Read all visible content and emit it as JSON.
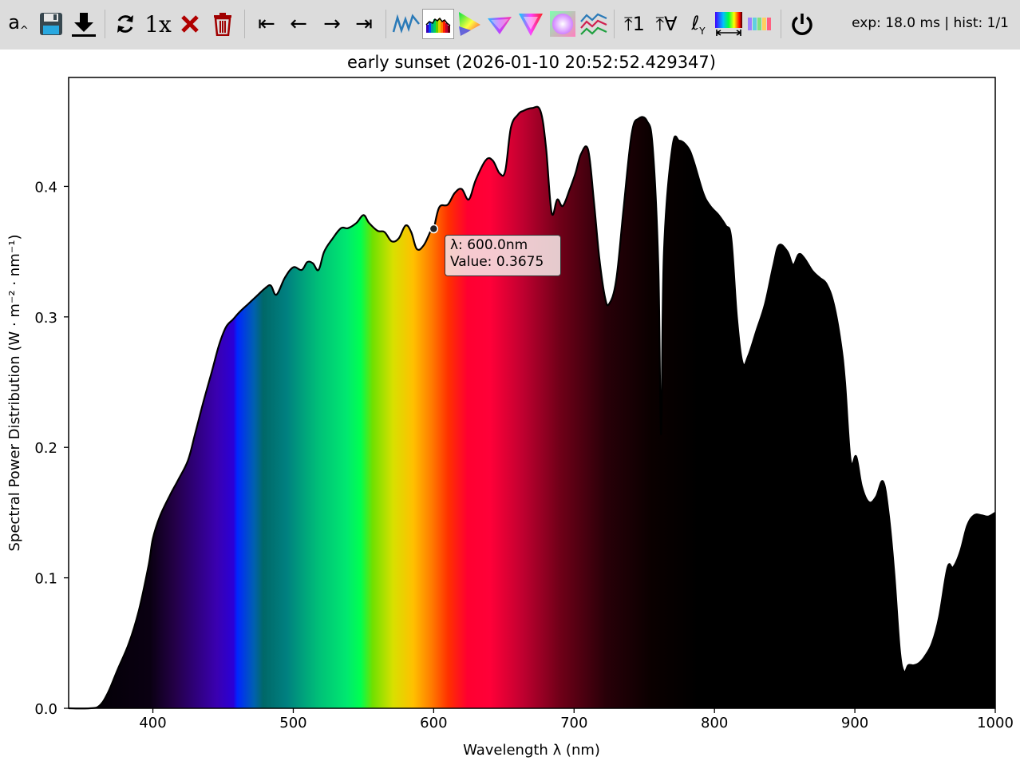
{
  "toolbar": {
    "font_size_label": "a",
    "speed_label": "1x",
    "status": "exp: 18.0 ms | hist: 1/1",
    "norm_one_label": "⤒1",
    "norm_all_label": "⤒∀",
    "log_label": "ℓ",
    "first_label": "⇤",
    "prev_label": "←",
    "next_label": "→",
    "last_label": "⇥"
  },
  "chart_data": {
    "type": "area",
    "title": "early sunset (2026-01-10 20:52:52.429347)",
    "xlabel": "Wavelength λ (nm)",
    "ylabel": "Spectral Power Distribution (W · m⁻² · nm⁻¹)",
    "xlim": [
      340,
      1000
    ],
    "ylim": [
      0,
      0.4835
    ],
    "xticks": [
      "400",
      "500",
      "600",
      "700",
      "800",
      "900",
      "1000"
    ],
    "yticks": [
      "0.0",
      "0.1",
      "0.2",
      "0.3",
      "0.4"
    ],
    "grid": false,
    "x": [
      340,
      355,
      362,
      368,
      375,
      383,
      390,
      397,
      400,
      405,
      412,
      418,
      425,
      430,
      436,
      442,
      447,
      452,
      457,
      462,
      468,
      474,
      480,
      484,
      488,
      494,
      500,
      506,
      510,
      514,
      518,
      522,
      528,
      534,
      539,
      545,
      550,
      554,
      560,
      565,
      570,
      575,
      580,
      584,
      588,
      593,
      598,
      600,
      604,
      610,
      615,
      620,
      625,
      630,
      637,
      642,
      647,
      651,
      655,
      660,
      664,
      670,
      676,
      680,
      684,
      688,
      692,
      697,
      701,
      705,
      710,
      714,
      718,
      722,
      725,
      730,
      735,
      741,
      746,
      752,
      756,
      760,
      762,
      764,
      770,
      775,
      781,
      785,
      792,
      797,
      803,
      808,
      812,
      816,
      820,
      824,
      830,
      836,
      842,
      846,
      852,
      856,
      860,
      864,
      870,
      875,
      880,
      885,
      890,
      893,
      897,
      901,
      905,
      910,
      915,
      920,
      924,
      928,
      932,
      935,
      938,
      942,
      946,
      950,
      955,
      960,
      966,
      970,
      975,
      980,
      985,
      990,
      995,
      1000
    ],
    "values": [
      0,
      0,
      0.002,
      0.012,
      0.03,
      0.05,
      0.075,
      0.11,
      0.13,
      0.147,
      0.163,
      0.175,
      0.19,
      0.21,
      0.235,
      0.258,
      0.278,
      0.292,
      0.298,
      0.304,
      0.31,
      0.316,
      0.322,
      0.324,
      0.317,
      0.33,
      0.338,
      0.336,
      0.342,
      0.341,
      0.336,
      0.35,
      0.36,
      0.368,
      0.368,
      0.372,
      0.378,
      0.372,
      0.366,
      0.365,
      0.358,
      0.36,
      0.37,
      0.365,
      0.352,
      0.355,
      0.366,
      0.3675,
      0.384,
      0.386,
      0.395,
      0.398,
      0.39,
      0.405,
      0.42,
      0.42,
      0.41,
      0.412,
      0.445,
      0.455,
      0.458,
      0.46,
      0.458,
      0.43,
      0.38,
      0.39,
      0.385,
      0.398,
      0.41,
      0.425,
      0.428,
      0.39,
      0.345,
      0.315,
      0.31,
      0.328,
      0.38,
      0.44,
      0.452,
      0.45,
      0.43,
      0.34,
      0.21,
      0.35,
      0.43,
      0.435,
      0.43,
      0.42,
      0.395,
      0.385,
      0.378,
      0.37,
      0.36,
      0.3,
      0.265,
      0.27,
      0.29,
      0.31,
      0.34,
      0.355,
      0.35,
      0.34,
      0.348,
      0.345,
      0.335,
      0.33,
      0.325,
      0.31,
      0.28,
      0.25,
      0.19,
      0.193,
      0.17,
      0.158,
      0.162,
      0.174,
      0.15,
      0.105,
      0.045,
      0.028,
      0.033,
      0.033,
      0.035,
      0.04,
      0.05,
      0.07,
      0.108,
      0.108,
      0.12,
      0.14,
      0.148,
      0.148,
      0.147,
      0.15
    ],
    "annotation": {
      "x": 600,
      "y": 0.3675,
      "line1": "λ: 600.0nm",
      "line2": "Value: 0.3675"
    }
  },
  "colors": {
    "toolbar_bg": "#dcdcdc",
    "curve": "#000000",
    "tooltip_bg": "#f5e6e6"
  }
}
